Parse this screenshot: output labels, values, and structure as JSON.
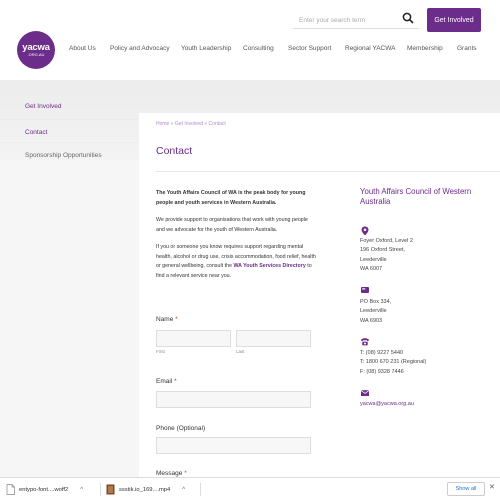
{
  "header": {
    "search_placeholder": "Enter your search term",
    "get_involved_label": "Get Involved",
    "logo_line1": "yacwa",
    "logo_line2": ".ORG.AU"
  },
  "nav": {
    "items": [
      "About Us",
      "Policy and Advocacy",
      "Youth Leadership",
      "Consulting",
      "Sector Support",
      "Regional YACWA",
      "Membership",
      "Grants"
    ]
  },
  "sidebar": {
    "title": "Get Involved",
    "items": [
      "Contact",
      "Sponsorship Opportunities"
    ]
  },
  "content": {
    "breadcrumb_home": "Home",
    "breadcrumb_sep1": " » ",
    "breadcrumb_parent": "Get Involved",
    "breadcrumb_sep2": " » ",
    "breadcrumb_current": "Contact",
    "title": "Contact",
    "intro_bold": "The Youth Affairs Council of WA is the peak body for young people and youth services in Western Australia.",
    "intro_p2": "We provide support to organisations that work with young people and we advocate for the youth of Western Australia.",
    "intro_p3_start": "If you or someone you know requires support regarding mental health, alcohol or drug use, crisis accommodation, food relief, health or general wellbeing, consult the ",
    "intro_p3_link": "WA Youth Services Directory",
    "intro_p3_end": " to find a relevant service near you."
  },
  "form": {
    "name_label": "Name",
    "required_mark": "*",
    "first_label": "First",
    "last_label": "Last",
    "email_label": "Email",
    "phone_label": "Phone (Optional)",
    "message_label": "Message"
  },
  "contact_info": {
    "org_title": "Youth Affairs Council of Western Australia",
    "address_lines": [
      "Foyer Oxford, Level 2",
      "196 Oxford Street,",
      "Leederville",
      "WA 6007"
    ],
    "po_lines": [
      "PO Box 334,",
      "Leederville",
      "WA 6903"
    ],
    "phone_lines": [
      "T: (08) 9227 5440",
      "T: 1800 670 231 (Regional)",
      "F: (08) 9328 7446"
    ],
    "email": "yacwa@yacwa.org.au"
  },
  "downloads": {
    "items": [
      "entypo-font....woff2",
      "ssstik.io_169....mp4"
    ],
    "show_all_label": "Show all"
  },
  "colors": {
    "brand": "#6b2c8a",
    "required": "#c0392b"
  }
}
